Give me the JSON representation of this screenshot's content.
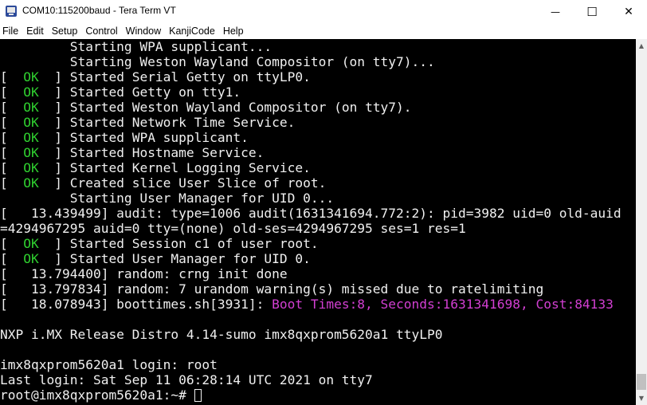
{
  "window": {
    "title": "COM10:115200baud - Tera Term VT",
    "minimize_glyph": "—",
    "maximize_glyph": "☐",
    "close_glyph": "✕"
  },
  "menu": [
    "File",
    "Edit",
    "Setup",
    "Control",
    "Window",
    "KanjiCode",
    "Help"
  ],
  "colors": {
    "background": "#000000",
    "text": "#f0f0f0",
    "ok": "#2fcf2f",
    "highlight": "#d23fd2"
  },
  "terminal": {
    "lines": [
      {
        "segments": [
          {
            "text": "         Starting WPA supplicant..."
          }
        ]
      },
      {
        "segments": [
          {
            "text": "         Starting Weston Wayland Compositor (on tty7)..."
          }
        ]
      },
      {
        "segments": [
          {
            "text": "[  "
          },
          {
            "text": "OK",
            "style": "ok"
          },
          {
            "text": "  ] Started Serial Getty on ttyLP0."
          }
        ]
      },
      {
        "segments": [
          {
            "text": "[  "
          },
          {
            "text": "OK",
            "style": "ok"
          },
          {
            "text": "  ] Started Getty on tty1."
          }
        ]
      },
      {
        "segments": [
          {
            "text": "[  "
          },
          {
            "text": "OK",
            "style": "ok"
          },
          {
            "text": "  ] Started Weston Wayland Compositor (on tty7)."
          }
        ]
      },
      {
        "segments": [
          {
            "text": "[  "
          },
          {
            "text": "OK",
            "style": "ok"
          },
          {
            "text": "  ] Started Network Time Service."
          }
        ]
      },
      {
        "segments": [
          {
            "text": "[  "
          },
          {
            "text": "OK",
            "style": "ok"
          },
          {
            "text": "  ] Started WPA supplicant."
          }
        ]
      },
      {
        "segments": [
          {
            "text": "[  "
          },
          {
            "text": "OK",
            "style": "ok"
          },
          {
            "text": "  ] Started Hostname Service."
          }
        ]
      },
      {
        "segments": [
          {
            "text": "[  "
          },
          {
            "text": "OK",
            "style": "ok"
          },
          {
            "text": "  ] Started Kernel Logging Service."
          }
        ]
      },
      {
        "segments": [
          {
            "text": "[  "
          },
          {
            "text": "OK",
            "style": "ok"
          },
          {
            "text": "  ] Created slice User Slice of root."
          }
        ]
      },
      {
        "segments": [
          {
            "text": "         Starting User Manager for UID 0..."
          }
        ]
      },
      {
        "segments": [
          {
            "text": "[   13.439499] audit: type=1006 audit(1631341694.772:2): pid=3982 uid=0 old-auid"
          }
        ]
      },
      {
        "segments": [
          {
            "text": "=4294967295 auid=0 tty=(none) old-ses=4294967295 ses=1 res=1"
          }
        ]
      },
      {
        "segments": [
          {
            "text": "[  "
          },
          {
            "text": "OK",
            "style": "ok"
          },
          {
            "text": "  ] Started Session c1 of user root."
          }
        ]
      },
      {
        "segments": [
          {
            "text": "[  "
          },
          {
            "text": "OK",
            "style": "ok"
          },
          {
            "text": "  ] Started User Manager for UID 0."
          }
        ]
      },
      {
        "segments": [
          {
            "text": "[   13.794400] random: crng init done"
          }
        ]
      },
      {
        "segments": [
          {
            "text": "[   13.797834] random: 7 urandom warning(s) missed due to ratelimiting"
          }
        ]
      },
      {
        "segments": [
          {
            "text": "[   18.078943] boottimes.sh[3931]: "
          },
          {
            "text": "Boot Times:8, Seconds:1631341698, Cost:84133",
            "style": "magenta"
          }
        ]
      },
      {
        "segments": [
          {
            "text": ""
          }
        ]
      },
      {
        "segments": [
          {
            "text": "NXP i.MX Release Distro 4.14-sumo imx8qxprom5620a1 ttyLP0"
          }
        ]
      },
      {
        "segments": [
          {
            "text": ""
          }
        ]
      },
      {
        "segments": [
          {
            "text": "imx8qxprom5620a1 login: root"
          }
        ]
      },
      {
        "segments": [
          {
            "text": "Last login: Sat Sep 11 06:28:14 UTC 2021 on tty7"
          }
        ]
      },
      {
        "segments": [
          {
            "text": "root@imx8qxprom5620a1:~# "
          }
        ],
        "cursor": true
      }
    ]
  }
}
